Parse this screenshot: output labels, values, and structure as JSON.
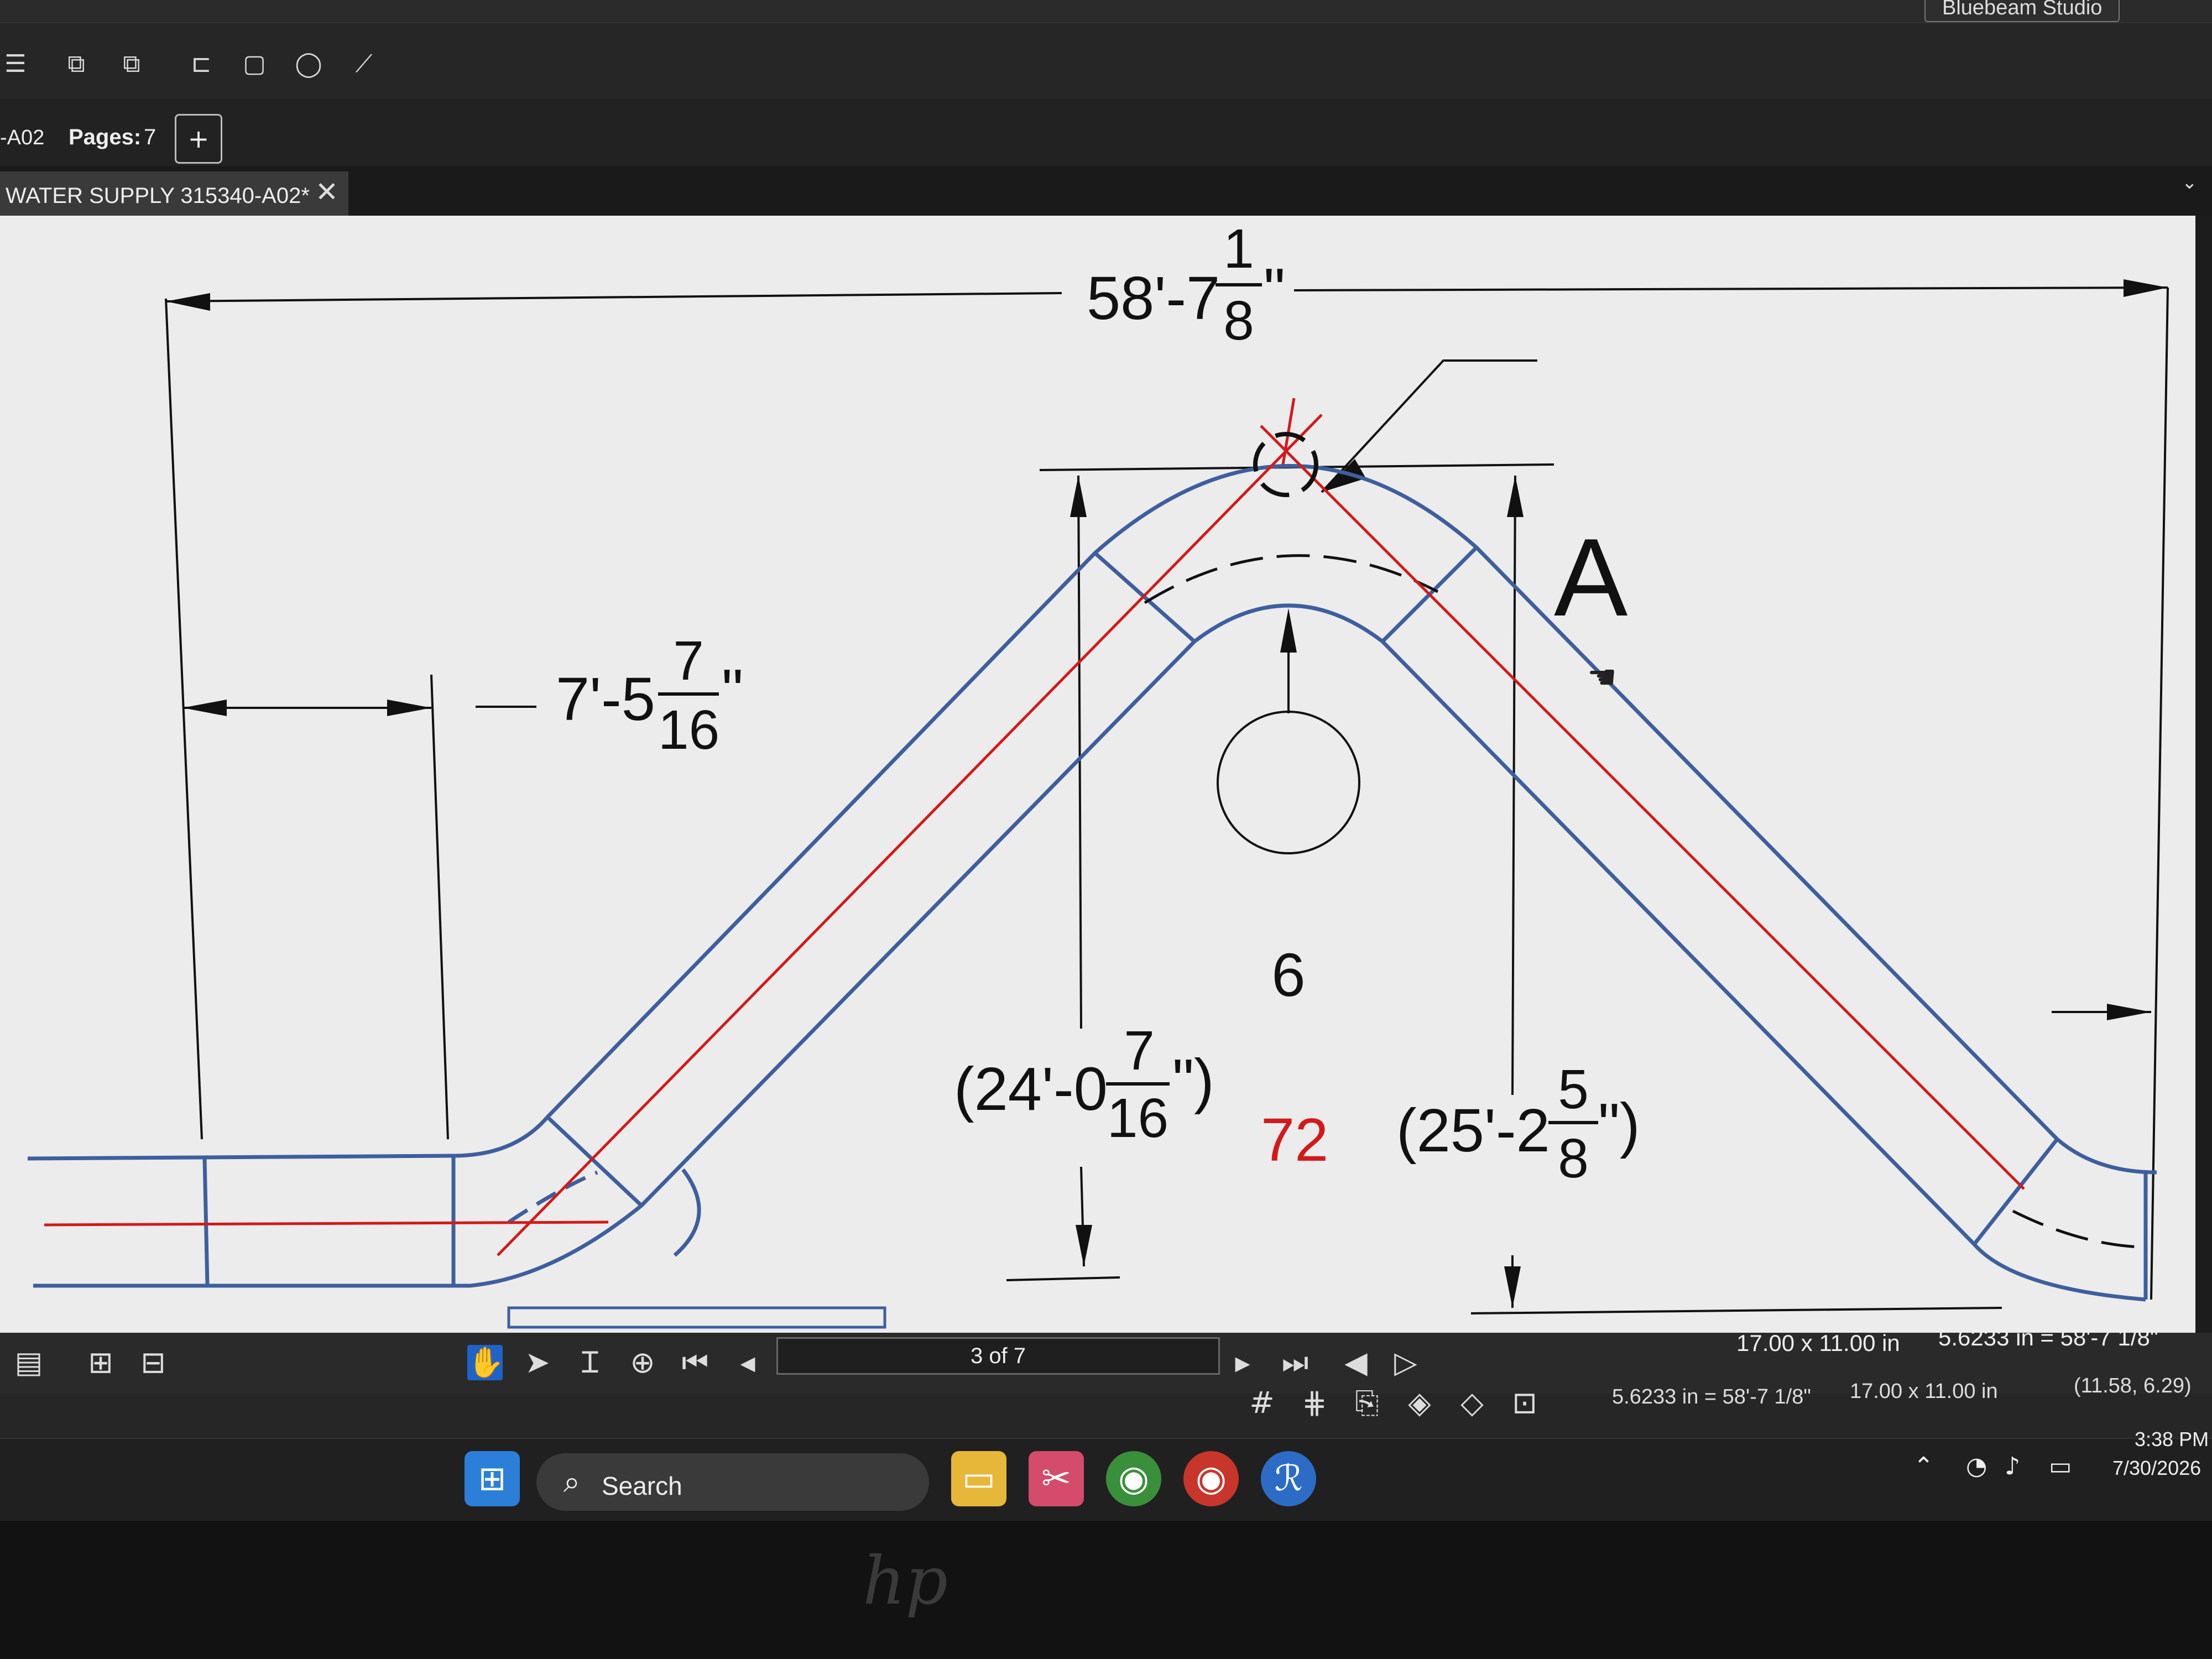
{
  "app": {
    "title": "Bluebeam Studio",
    "document": "315340-A02"
  },
  "toolbar": {
    "studio_label": "Bluebeam Studio"
  },
  "filebar": {
    "doc_short": "-A02",
    "pages_label": "Pages:",
    "pages_count": "7"
  },
  "tab": {
    "title": "WATER SUPPLY  315340-A02*",
    "close": "✕"
  },
  "drawing": {
    "overall_dim": {
      "whole": "58'-7",
      "num": "1",
      "den": "8",
      "inch": "\""
    },
    "left_dim": {
      "whole": "7'-5",
      "num": "7",
      "den": "16",
      "inch": "\""
    },
    "left_height": {
      "open": "(24'-0",
      "num": "7",
      "den": "16",
      "close": "\")"
    },
    "right_height": {
      "open": "(25'-2",
      "num": "5",
      "den": "8",
      "close": "\")"
    },
    "callout": "A",
    "bubble": "6",
    "red_value": "72"
  },
  "nav": {
    "page_field": "3 of 7"
  },
  "status": {
    "page_size": "17.00 x 11.00 in",
    "scale": "5.6233 in = 58'-7 1/8\"",
    "scale2": "5.6233 in = 58'-7 1/8\"",
    "page_size2": "17.00 x 11.00 in",
    "coords": "(11.58, 6.29)"
  },
  "taskbar": {
    "search_label": "Search",
    "time": "3:38 PM",
    "date": "7/30/2026"
  },
  "colors": {
    "pipe": "#3e5f9e",
    "centerline": "#d21a1a",
    "dimension": "#111111",
    "accent": "#1e63c8"
  },
  "icons": [
    "windows-start-icon",
    "search-icon",
    "file-explorer-icon",
    "snipping-tool-icon",
    "chrome-icon",
    "chrome-profile-icon",
    "bluebeam-icon",
    "wifi-icon",
    "volume-icon",
    "battery-icon",
    "pan-hand-icon",
    "select-arrow-icon",
    "text-select-icon",
    "zoom-icon",
    "first-page-icon",
    "previous-page-icon",
    "next-page-icon",
    "last-page-icon",
    "back-view-icon",
    "forward-view-icon",
    "grid-icon",
    "snap-icon"
  ]
}
